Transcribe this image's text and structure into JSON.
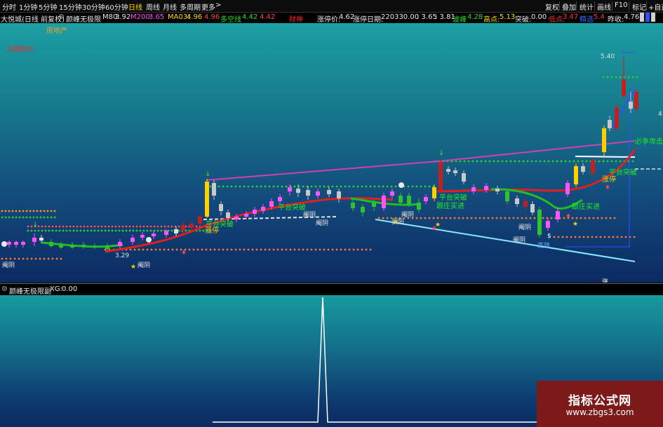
{
  "toolbar": {
    "periods": [
      "分时",
      "1分钟",
      "5分钟",
      "15分钟",
      "30分钟",
      "60分钟",
      "日线",
      "周线",
      "月线",
      "多周期",
      "更多"
    ],
    "active_period": "日线",
    "more_arrow": ">",
    "right_buttons": [
      "复权",
      "叠加",
      "统计",
      "画线",
      "F10",
      "标记",
      "+自选"
    ]
  },
  "infobar": {
    "stock": "大悦城(日线 前复权)",
    "indicator_name": "颜峰无极限",
    "m80_label": "M80:",
    "m80_value": "3.92",
    "m200_label": "M200:",
    "m200_value": "3.65",
    "ma03_label": "MA03:",
    "ma03_value": "4.96",
    "ma03_value2": "4.96",
    "duokong_label": "多空线",
    "duokong_v1": "4.42",
    "duokong_v2": "4.42",
    "caishen": "财神",
    "zhangting_price_label": "涨停价:",
    "zhangting_price": "4.62",
    "zhangting_date_label": "涨停日期:",
    "zhangting_date": "220330.00",
    "v1": ": 3.65",
    "v2": ": 3.81",
    "bolang_label": "波峰",
    "bolang_value": "4.28",
    "gaodian_label": "高点:",
    "gaodian_value": "5.13",
    "tupo_label": "突破:",
    "tupo_value": "0.00",
    "didian_label": "低点:",
    "didian_value": "3.47",
    "jiancha_label": "精选",
    "jiancha_value": "5.4",
    "zuoshou_label": "昨收:",
    "zuoshou_value": "4.76"
  },
  "chart": {
    "sector": "房地产",
    "main_hint": "主题提示!",
    "peak_label": "5.40",
    "low_label": "3.29",
    "right_edge": "4",
    "bottom_marker": "涨",
    "annotations": {
      "ping_tai_tupo": "平台突破",
      "gen_zhuang_mai_jin": "跟庄买进",
      "bi_zheng_gong_ji": "必争攻击",
      "zhang_ting": "涨停",
      "jian_yang": "阉阴",
      "dan_yang": "剑阳",
      "gao_xiao": "高效",
      "zhu_dong": "主动"
    },
    "colors": {
      "up_candle": "#ff55ff",
      "down_candle": "#30c030",
      "accent_red": "#ff3030",
      "accent_magenta": "#ff44c8",
      "support_line": "#7fe8ff",
      "gold": "#ffd000"
    }
  },
  "sub": {
    "indicator": "颜峰无极限副",
    "xg_label": "XG:",
    "xg_value": "0.00"
  },
  "watermark": {
    "title": "指标公式网",
    "url": "www.zbgs3.com"
  }
}
